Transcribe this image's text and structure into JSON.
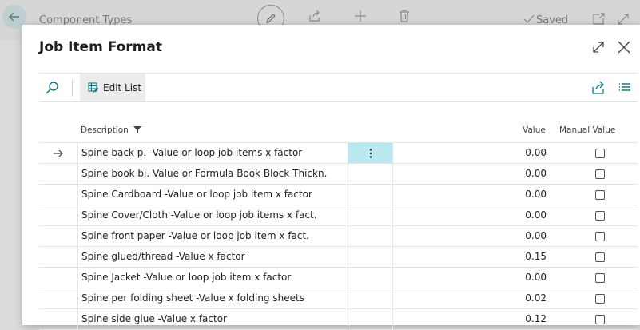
{
  "background": {
    "title": "Component Types",
    "saved_label": "Saved"
  },
  "dialog": {
    "title": "Job Item Format"
  },
  "actionbar": {
    "edit_list_label": "Edit List"
  },
  "columns": {
    "description": "Description",
    "value": "Value",
    "manual_value": "Manual Value"
  },
  "rows": [
    {
      "description": "Spine back p. -Value or loop job items x factor",
      "value": "0.00",
      "manual": false,
      "active": true
    },
    {
      "description": "Spine book bl. Value or Formula Book Block Thickn.",
      "value": "0.00",
      "manual": false,
      "active": false
    },
    {
      "description": "Spine Cardboard -Value or loop job item x factor",
      "value": "0.00",
      "manual": false,
      "active": false
    },
    {
      "description": "Spine Cover/Cloth -Value or loop job items x fact.",
      "value": "0.00",
      "manual": false,
      "active": false
    },
    {
      "description": "Spine front paper -Value or loop job item x fact.",
      "value": "0.00",
      "manual": false,
      "active": false
    },
    {
      "description": "Spine glued/thread -Value x factor",
      "value": "0.15",
      "manual": false,
      "active": false
    },
    {
      "description": "Spine Jacket -Value or loop job item x factor",
      "value": "0.00",
      "manual": false,
      "active": false
    },
    {
      "description": "Spine per folding sheet -Value x folding sheets",
      "value": "0.02",
      "manual": false,
      "active": false
    },
    {
      "description": "Spine side glue -Value x factor",
      "value": "0.12",
      "manual": false,
      "active": false
    }
  ],
  "colors": {
    "accent": "#0e7a8a",
    "active_cell": "#b9e8f0"
  }
}
